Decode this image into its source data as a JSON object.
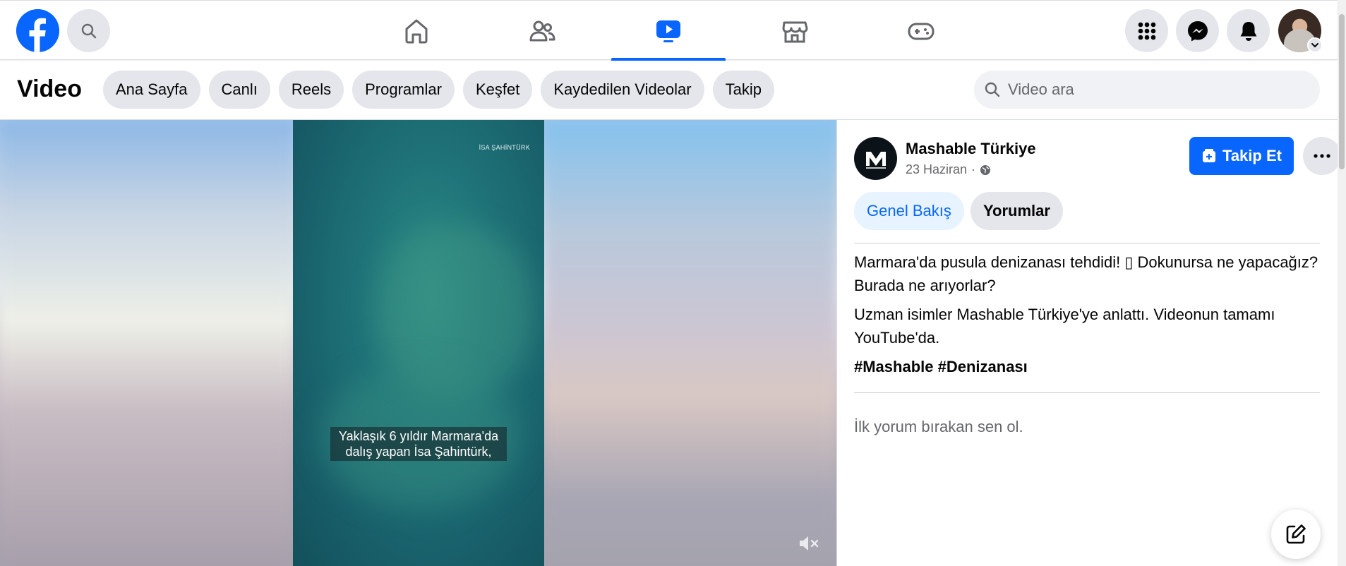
{
  "topbar": {
    "nav_tabs": [
      {
        "name": "home",
        "icon": "home-icon",
        "active": false
      },
      {
        "name": "friends",
        "icon": "friends-icon",
        "active": false
      },
      {
        "name": "video",
        "icon": "video-icon",
        "active": true
      },
      {
        "name": "marketplace",
        "icon": "marketplace-icon",
        "active": false
      },
      {
        "name": "gaming",
        "icon": "gaming-icon",
        "active": false
      }
    ],
    "accent_color": "#0866ff"
  },
  "subbar": {
    "title": "Video",
    "chips": [
      "Ana Sayfa",
      "Canlı",
      "Reels",
      "Programlar",
      "Keşfet",
      "Kaydedilen Videolar",
      "Takip"
    ],
    "search_placeholder": "Video ara"
  },
  "video": {
    "watermark": "İSA ŞAHİNTÜRK",
    "caption_line1": "Yaklaşık 6 yıldır Marmara'da",
    "caption_line2": "dalış yapan İsa Şahintürk,"
  },
  "post": {
    "page_name": "Mashable Türkiye",
    "date": "23 Haziran",
    "separator": "·",
    "follow_label": "Takip Et",
    "tabs": {
      "overview": "Genel Bakış",
      "comments": "Yorumlar"
    },
    "text_para1": "Marmara'da pusula denizanası tehdidi! ▯ Dokunursa ne yapacağız? Burada ne arıyorlar?",
    "text_para2": "Uzman isimler Mashable Türkiye'ye anlattı. Videonun tamamı YouTube'da.",
    "hashtags": "#Mashable #Denizanası",
    "no_comments": "İlk yorum bırakan sen ol."
  }
}
